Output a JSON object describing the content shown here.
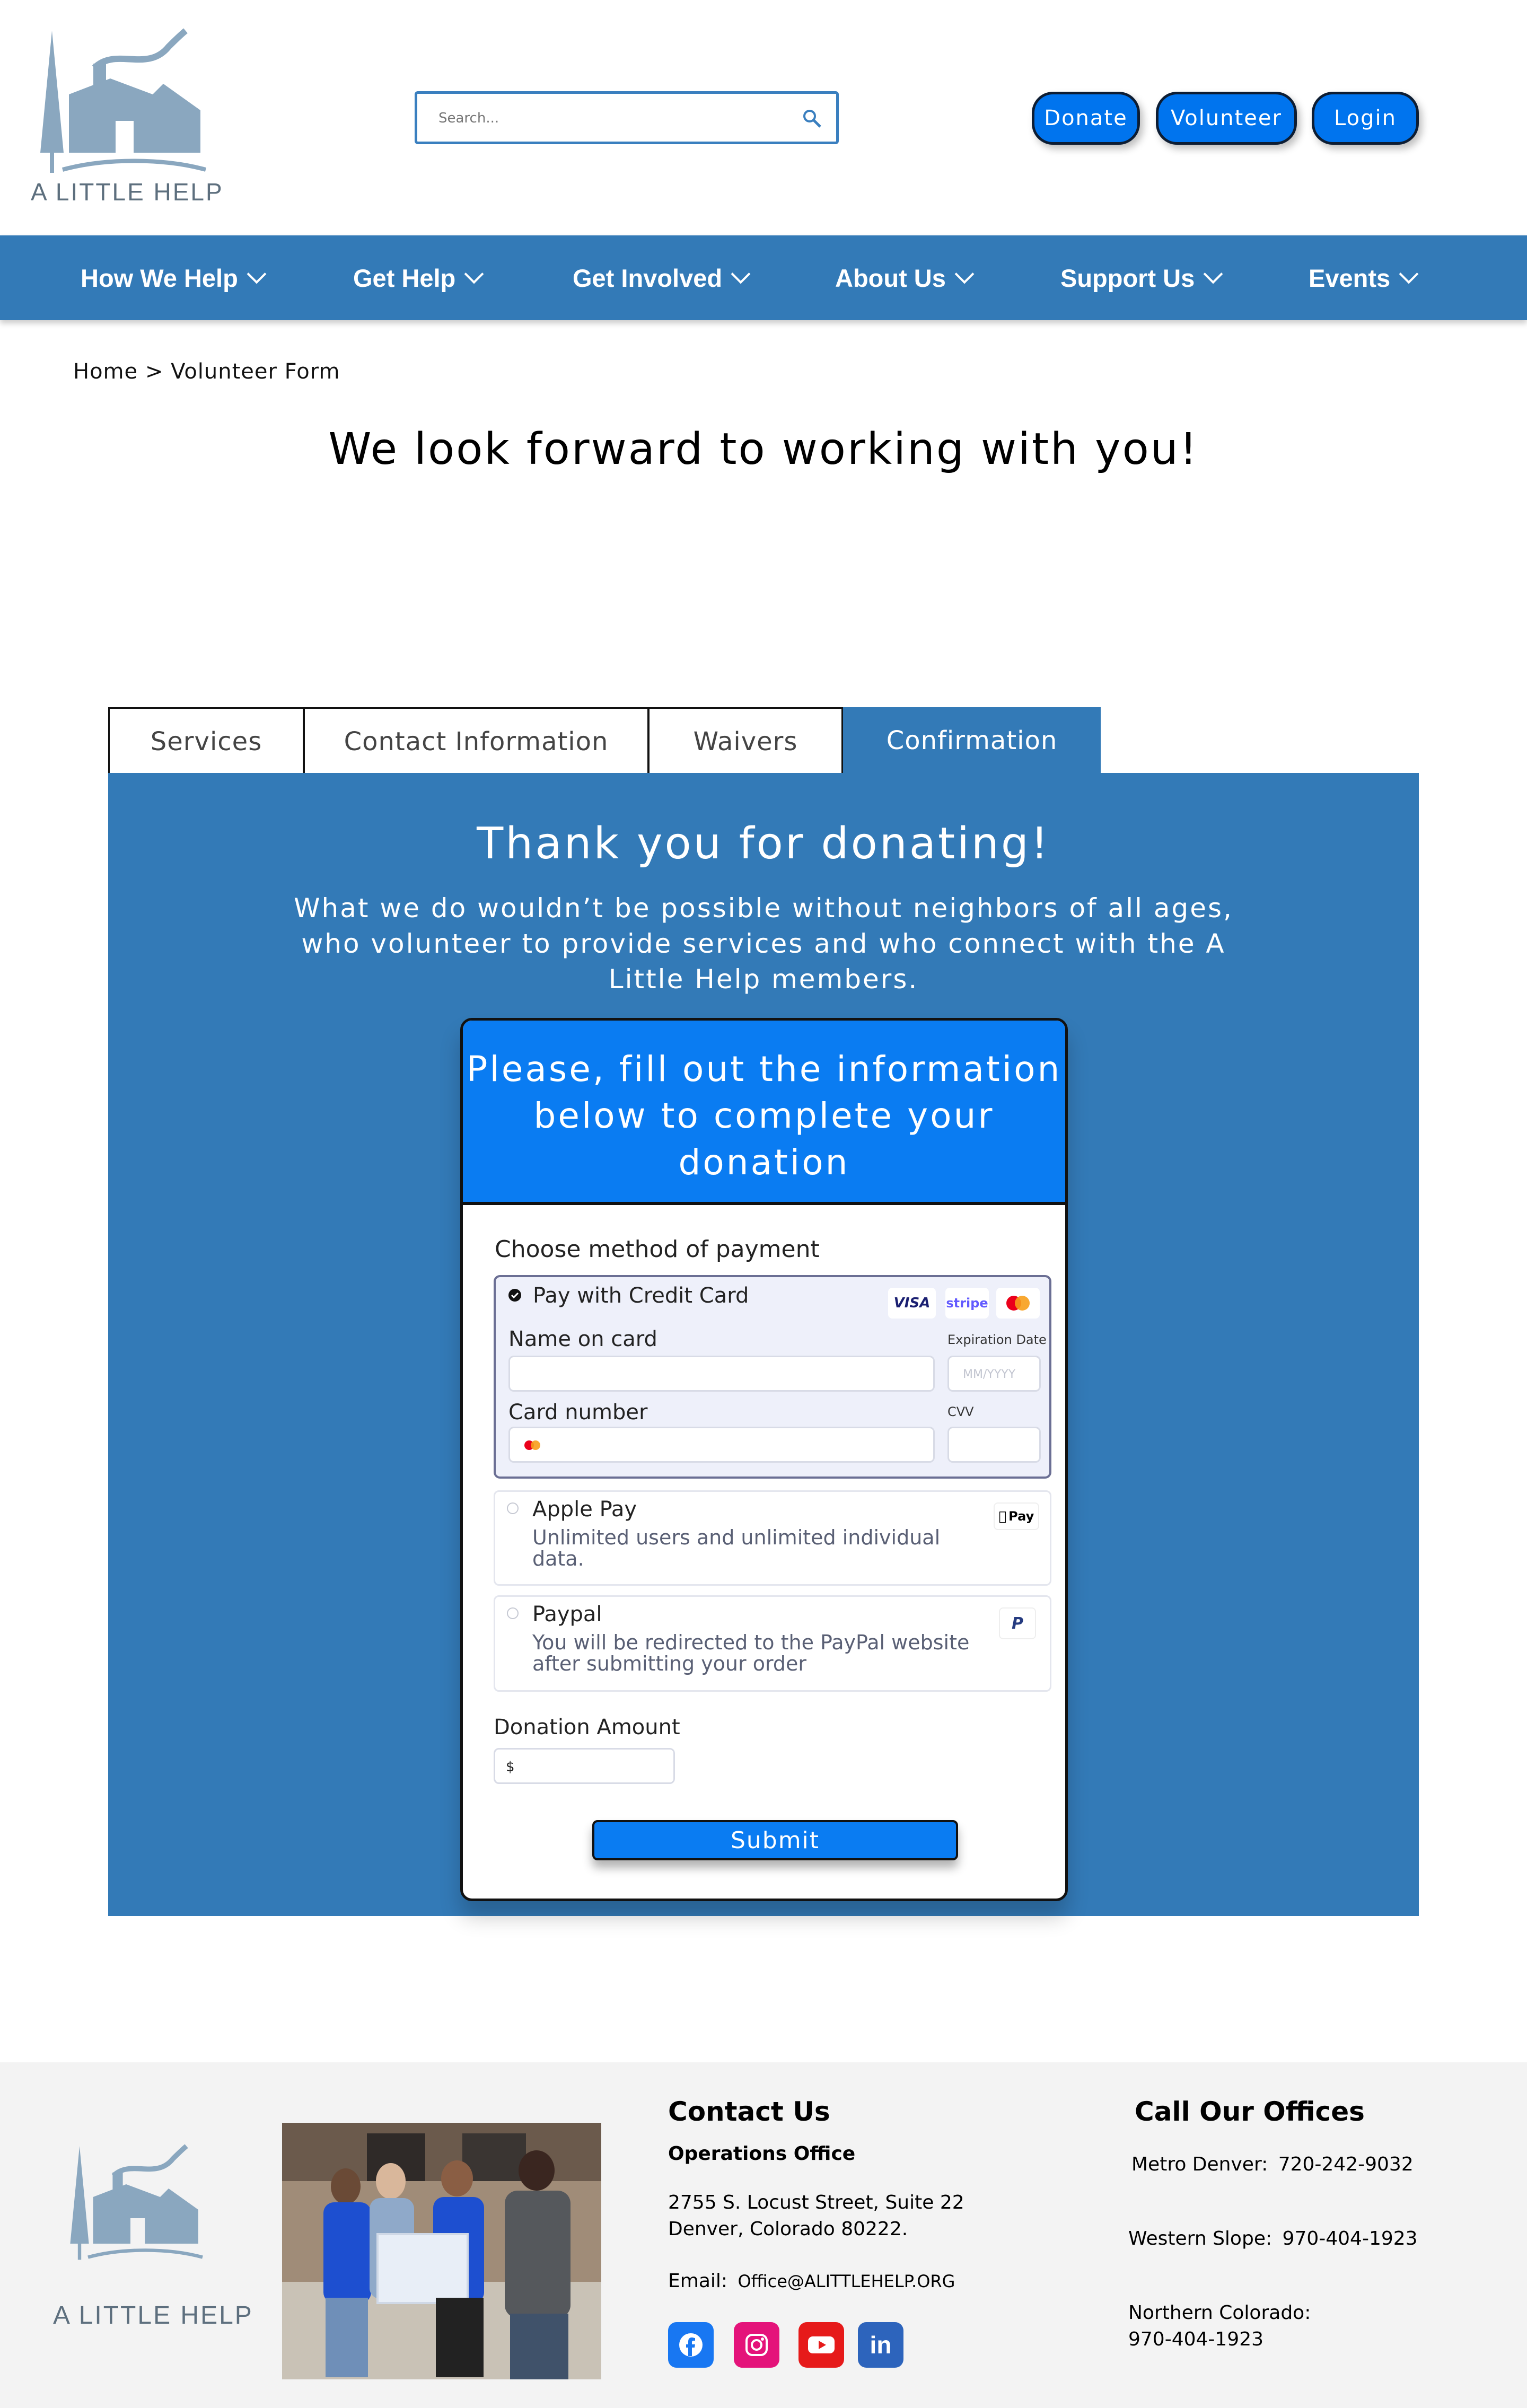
{
  "header": {
    "logo_text": "A LITTLE HELP",
    "search_placeholder": "Search...",
    "buttons": {
      "donate": "Donate",
      "volunteer": "Volunteer",
      "login": "Login"
    }
  },
  "nav": {
    "items": [
      "How We Help",
      "Get Help",
      "Get Involved",
      "About Us",
      "Support Us",
      "Events"
    ]
  },
  "breadcrumb": "Home > Volunteer Form",
  "headline": "We look forward to working with you!",
  "tabs": [
    "Services",
    "Contact Information",
    "Waivers",
    "Confirmation"
  ],
  "active_tab": "Confirmation",
  "panel": {
    "title": "Thank you for donating!",
    "text": "What we do wouldn’t be possible without neighbors of all ages, who volunteer to provide services and who connect with the A Little Help members."
  },
  "form": {
    "heading": "Please, fill out the information below to complete your donation",
    "payment_label": "Choose method of payment",
    "credit_card": {
      "label": "Pay with Credit Card",
      "selected": true,
      "name_label": "Name on card",
      "expiration_label": "Expiration Date",
      "expiration_placeholder": "MM/YYYY",
      "card_number_label": "Card number",
      "cvv_label": "CVV",
      "badges": [
        "VISA",
        "stripe",
        "mastercard"
      ]
    },
    "apple_pay": {
      "label": "Apple Pay",
      "description": "Unlimited users and unlimited individual data.",
      "badge": "Pay"
    },
    "paypal": {
      "label": "Paypal",
      "description": "You will be redirected to the PayPal website after submitting your order",
      "badge": "P"
    },
    "amount_label": "Donation Amount",
    "amount_prefix": "$",
    "submit_label": "Submit"
  },
  "footer": {
    "logo_text": "A LITTLE HELP",
    "contact_heading": "Contact Us",
    "office_name": "Operations Office",
    "address_line1": "2755  S. Locust Street, Suite 22",
    "address_line2": "Denver, Colorado 80222.",
    "email_label": "Email:",
    "email": "Office@ALITTLEHELP.ORG",
    "call_heading": "Call Our Offices",
    "offices": [
      {
        "label": "Metro Denver:",
        "phone": "720-242-9032"
      },
      {
        "label": "Western Slope:",
        "phone": "970-404-1923"
      },
      {
        "label": "Northern Colorado:",
        "phone": "970-404-1923"
      }
    ],
    "social": [
      "facebook",
      "instagram",
      "youtube",
      "linkedin"
    ],
    "colors": {
      "facebook": "#1877f2",
      "instagram": "#e4137a",
      "youtube": "#e61a1a",
      "linkedin": "#2d64bc"
    }
  },
  "colors": {
    "primary_blue": "#337ab7",
    "accent_blue": "#0a7cf2",
    "button_blue": "#0074ee"
  }
}
